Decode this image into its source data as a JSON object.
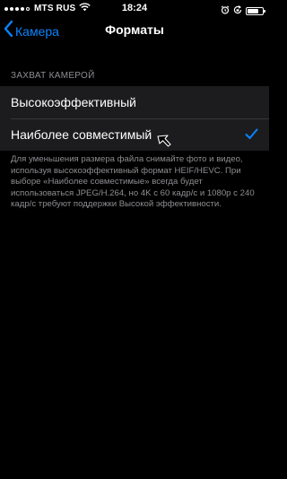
{
  "status_bar": {
    "carrier": "MTS RUS",
    "time": "18:24",
    "signal_strength": 4,
    "battery_level": 0.75
  },
  "nav": {
    "back_label": "Камера",
    "title": "Форматы"
  },
  "section": {
    "header": "ЗАХВАТ КАМЕРОЙ",
    "options": [
      {
        "label": "Высокоэффективный",
        "selected": false
      },
      {
        "label": "Наиболее совместимый",
        "selected": true
      }
    ],
    "footer": "Для уменьшения размера файла снимайте фото и видео, используя высокоэффективный формат HEIF/HEVC. При выборе «Наиболее совместимые» всегда будет использоваться JPEG/H.264, но 4K с 60 кадр/с и 1080p с 240 кадр/с требуют поддержки Высокой эффективности."
  },
  "colors": {
    "accent": "#0a84ff",
    "background": "#000000",
    "cell_background": "#1c1c1e",
    "secondary_text": "#8e8e93"
  }
}
